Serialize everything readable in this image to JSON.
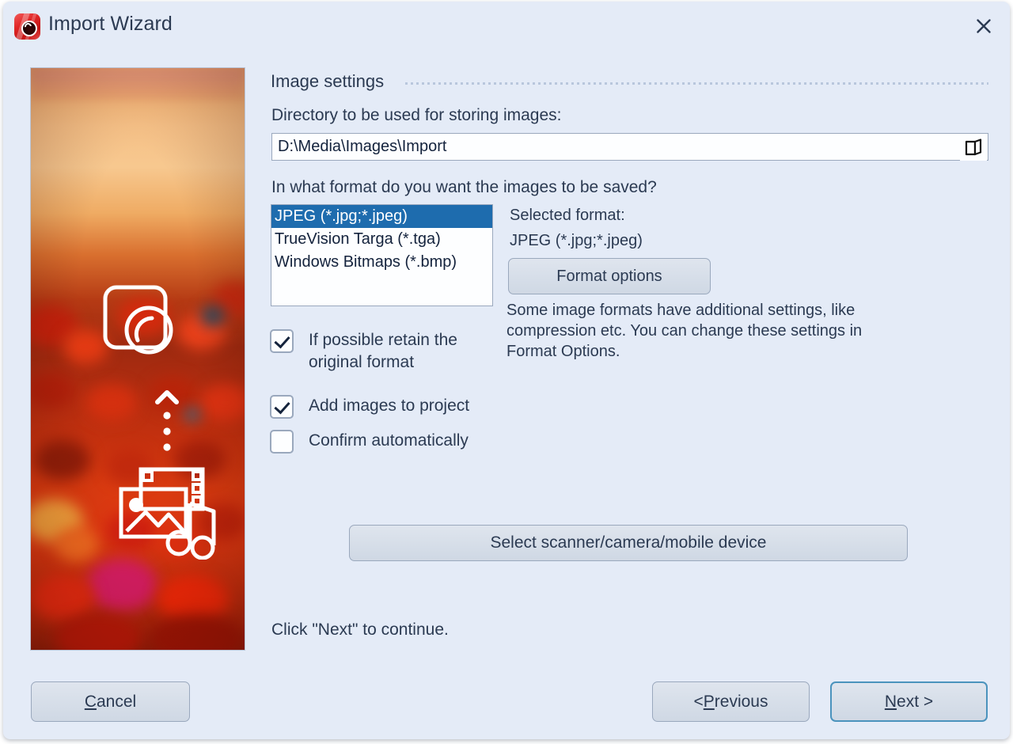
{
  "window": {
    "title": "Import Wizard",
    "app_icon": "camera-lens-icon",
    "close_icon": "close-icon"
  },
  "preview": {
    "name": "poppy-field-sunset-photo",
    "overlay_icons": [
      "app-logo-icon",
      "up-arrow-dots-icon",
      "media-photo-music-icon"
    ]
  },
  "main": {
    "section_title": "Image settings",
    "directory_label": "Directory to be used for storing images:",
    "directory_value": "D:\\Media\\Images\\Import",
    "browse_icon": "open-folder-icon",
    "format_question": "In what format do you want the images to be saved?",
    "format_options": [
      {
        "label": "JPEG (*.jpg;*.jpeg)",
        "selected": true
      },
      {
        "label": "TrueVision Targa (*.tga)",
        "selected": false
      },
      {
        "label": "Windows Bitmaps (*.bmp)",
        "selected": false
      }
    ],
    "selected_format_label": "Selected format:",
    "selected_format_value": "JPEG (*.jpg;*.jpeg)",
    "format_options_button": "Format options",
    "format_description": "Some image formats have additional settings, like compression etc. You can change these settings in Format Options.",
    "checkboxes": [
      {
        "label": "If possible retain the\noriginal format",
        "checked": true
      },
      {
        "label": "Add images to project",
        "checked": true
      },
      {
        "label": "Confirm automatically",
        "checked": false
      }
    ],
    "scanner_button": "Select scanner/camera/mobile device",
    "hint": "Click \"Next\" to continue."
  },
  "footer": {
    "cancel": {
      "accel": "C",
      "rest": "ancel"
    },
    "previous": {
      "prefix": "< ",
      "accel": "P",
      "rest": "revious"
    },
    "next": {
      "accel": "N",
      "rest": "ext >"
    }
  },
  "colors": {
    "window_bg": "#e4ebf7",
    "selection_blue": "#1e6cae",
    "default_button_border": "#4b93bd",
    "text": "#2b3a52"
  }
}
